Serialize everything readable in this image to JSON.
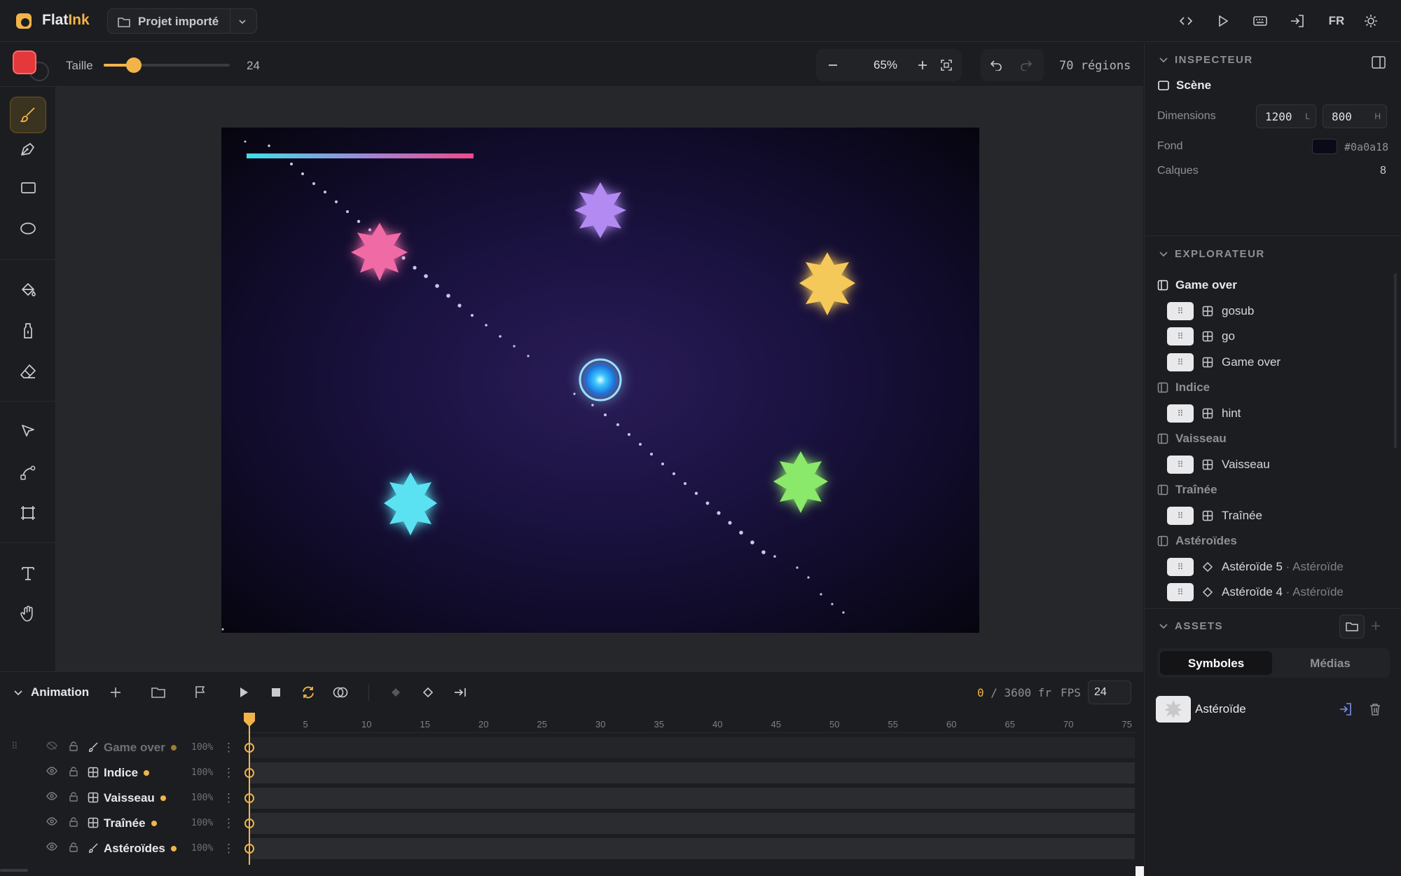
{
  "app": {
    "name_main": "Flat",
    "name_accent": "Ink",
    "project": "Projet importé",
    "language": "FR"
  },
  "toolbar": {
    "size_label": "Taille",
    "size_value": "24",
    "size_fraction": 0.24,
    "zoom": "65%",
    "regions": "70 régions",
    "brush_color": "#e5383b"
  },
  "tools": [
    "brush",
    "pen",
    "rectangle",
    "ellipse",
    "fill",
    "bucket",
    "eraser",
    "select",
    "bezier",
    "transform",
    "text",
    "hand"
  ],
  "timeline": {
    "title": "Animation",
    "current_frame": "0",
    "total_frames": "/ 3600 fr",
    "fps_label": "FPS",
    "fps": "24",
    "ticks": [
      "5",
      "10",
      "15",
      "20",
      "25",
      "30",
      "35",
      "40",
      "45",
      "50",
      "55",
      "60",
      "65",
      "70",
      "75"
    ],
    "layers": [
      {
        "name": "Game over",
        "opacity": "100%",
        "type": "brush",
        "dim": true
      },
      {
        "name": "Indice",
        "opacity": "100%",
        "type": "symbol",
        "dim": false
      },
      {
        "name": "Vaisseau",
        "opacity": "100%",
        "type": "symbol",
        "dim": false
      },
      {
        "name": "Traînée",
        "opacity": "100%",
        "type": "symbol",
        "dim": false
      },
      {
        "name": "Astéroïdes",
        "opacity": "100%",
        "type": "brush",
        "dim": false
      }
    ]
  },
  "inspector": {
    "header": "INSPECTEUR",
    "scene_label": "Scène",
    "dimensions_label": "Dimensions",
    "width": "1200",
    "width_unit": "L",
    "height": "800",
    "height_unit": "H",
    "background_label": "Fond",
    "background_value": "#0a0a18",
    "layers_label": "Calques",
    "layers_count": "8"
  },
  "explorer": {
    "header": "EXPLORATEUR",
    "tree": [
      {
        "kind": "group",
        "label": "Game over",
        "active": true
      },
      {
        "kind": "item",
        "label": "gosub",
        "icon": "symbol"
      },
      {
        "kind": "item",
        "label": "go",
        "icon": "symbol"
      },
      {
        "kind": "item",
        "label": "Game over",
        "icon": "symbol"
      },
      {
        "kind": "group",
        "label": "Indice"
      },
      {
        "kind": "item",
        "label": "hint",
        "icon": "symbol"
      },
      {
        "kind": "group",
        "label": "Vaisseau"
      },
      {
        "kind": "item",
        "label": "Vaisseau",
        "icon": "symbol"
      },
      {
        "kind": "group",
        "label": "Traînée"
      },
      {
        "kind": "item",
        "label": "Traînée",
        "icon": "symbol"
      },
      {
        "kind": "group",
        "label": "Astéroïdes"
      },
      {
        "kind": "item",
        "label": "Astéroïde 5",
        "sub": " · Astéroïde",
        "icon": "diamond"
      },
      {
        "kind": "item",
        "label": "Astéroïde 4",
        "sub": " · Astéroïde",
        "icon": "diamond"
      }
    ]
  },
  "assets": {
    "header": "ASSETS",
    "tab_symbols": "Symboles",
    "tab_media": "Médias",
    "items": [
      {
        "name": "Astéroïde"
      }
    ]
  },
  "colors": {
    "accent": "#f2b44a",
    "scene_bg": "#0a0a18"
  }
}
